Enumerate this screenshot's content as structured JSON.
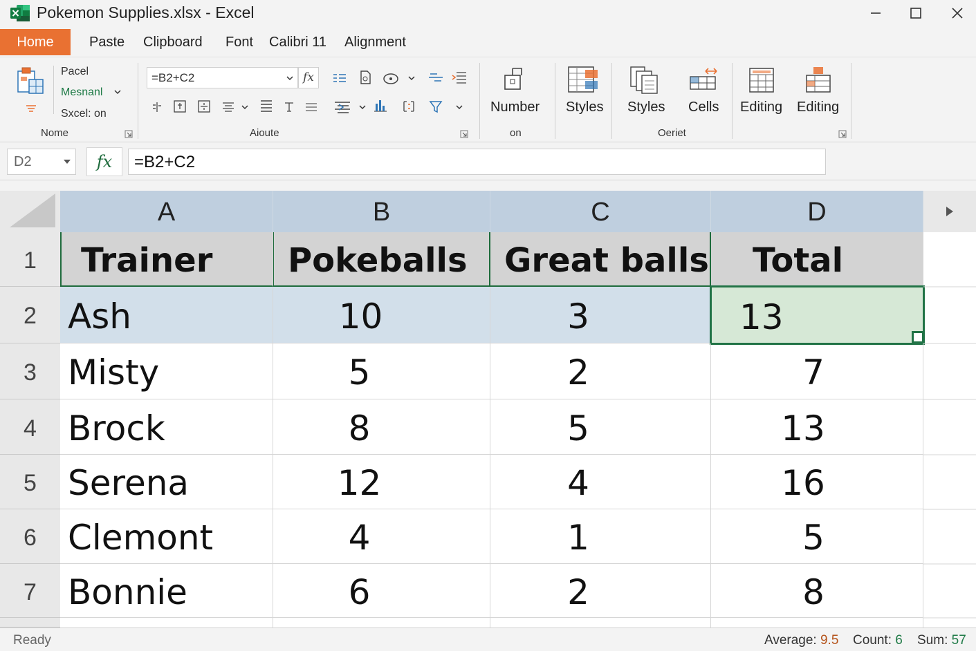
{
  "window": {
    "title": "Pokemon Supplies.xlsx - Excel",
    "controls": [
      "minimize-icon",
      "maximize-icon",
      "close-icon"
    ]
  },
  "menu": {
    "items": [
      "Home",
      "Paste",
      "Clipboard",
      "Font",
      "Calibri 11",
      "Alignment"
    ],
    "active": "Home",
    "active_color": "#e97132"
  },
  "ribbon": {
    "clipboard_items": [
      "Pacel",
      "Mesnanl",
      "Sxcel: on"
    ],
    "name_box_value": "=B2+C2",
    "groups": {
      "nome": "Nome",
      "aioute": "Aioute",
      "number_sub": "on",
      "oeriet": "Oeriet"
    },
    "buttons": {
      "number": "Number",
      "styles_1": "Styles",
      "styles_2": "Styles",
      "cells": "Cells",
      "editing_1": "Editing",
      "editing_2": "Editing"
    }
  },
  "formula_bar": {
    "name_box": "D2",
    "fx": "fx",
    "formula": "=B2+C2"
  },
  "sheet": {
    "columns": [
      "A",
      "B",
      "C",
      "D"
    ],
    "rows": [
      "1",
      "2",
      "3",
      "4",
      "5",
      "6",
      "7"
    ],
    "header": [
      "Trainer",
      "Pokeballs",
      "Great balls",
      "Total"
    ],
    "data": [
      [
        "Ash",
        "10",
        "3",
        "13"
      ],
      [
        "Misty",
        "5",
        "2",
        "7"
      ],
      [
        "Brock",
        "8",
        "5",
        "13"
      ],
      [
        "Serena",
        "12",
        "4",
        "16"
      ],
      [
        "Clemont",
        "4",
        "1",
        "5"
      ],
      [
        "Bonnie",
        "6",
        "2",
        "8"
      ]
    ],
    "active_cell": "D2",
    "selection_color": "#217346"
  },
  "status_bar": {
    "ready": "Ready",
    "average_label": "Average:",
    "average_value": "9.5",
    "count_label": "Count:",
    "count_value": "6",
    "sum_label": "Sum:",
    "sum_value": "57"
  }
}
